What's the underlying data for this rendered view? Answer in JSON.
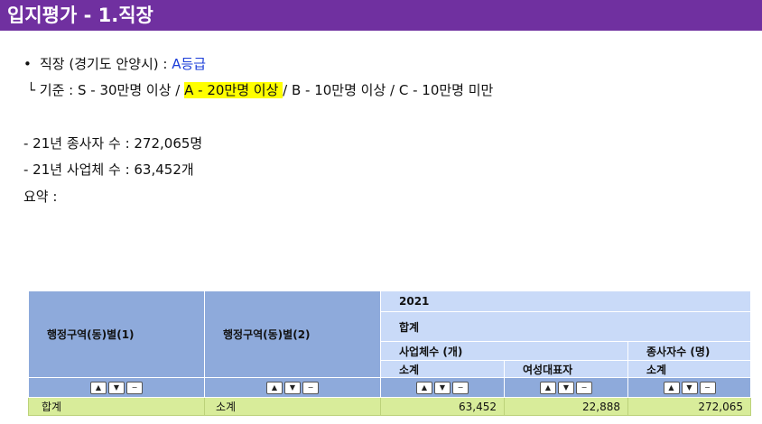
{
  "header": {
    "title": "입지평가 - 1.직장"
  },
  "summary": {
    "workplace_label": "직장 (경기도 안양시) : ",
    "workplace_grade": "A등급",
    "criteria_prefix": "└ 기준 : S - 30만명 이상 / ",
    "criteria_highlight": "A - 20만명 이상 ",
    "criteria_suffix": "/ B - 10만명 이상 / C - 10만명 미만",
    "employees": "- 21년 종사자 수 : 272,065명",
    "businesses": "- 21년 사업체 수 : 63,452개",
    "summary_label": "요약 :"
  },
  "table": {
    "col1_header": "행정구역(동)별(1)",
    "col2_header": "행정구역(동)별(2)",
    "year": "2021",
    "total": "합계",
    "group1": "사업체수 (개)",
    "group2": "종사자수 (명)",
    "sub1": "소계",
    "sub2": "여성대표자",
    "sub3": "소계",
    "row": {
      "col1": "합계",
      "col2": "소계",
      "v1": "63,452",
      "v2": "22,888",
      "v3": "272,065"
    }
  },
  "controls": {
    "up": "▲",
    "down": "▼",
    "minus": "−"
  },
  "colors": {
    "title_bg": "#7030a0",
    "header_dark": "#8eaadb",
    "header_light": "#c9daf8",
    "row_bg": "#d8ec9a",
    "highlight": "#ffff00"
  }
}
